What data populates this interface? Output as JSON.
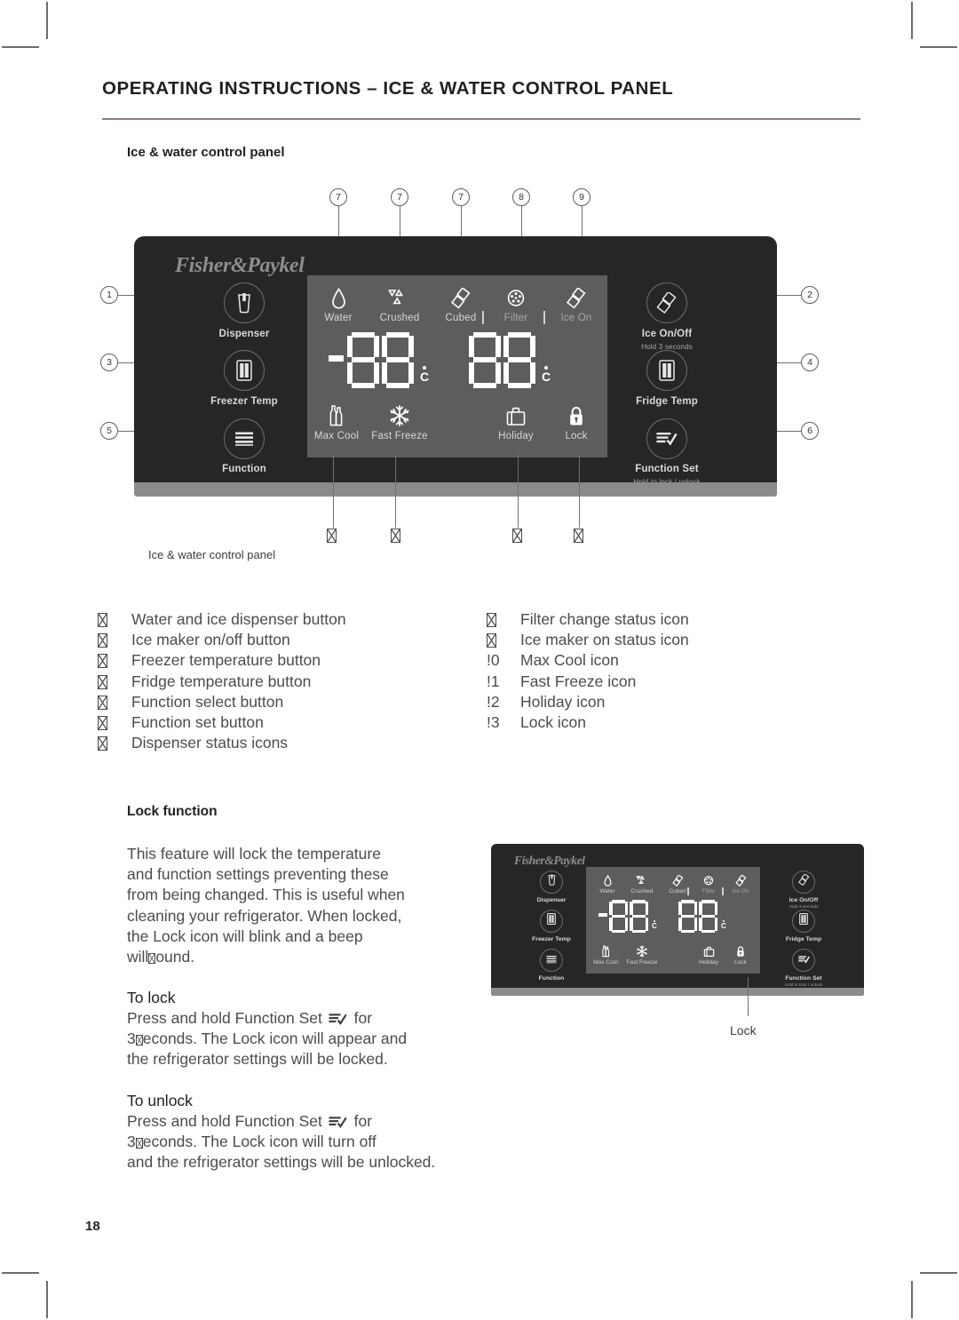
{
  "document": {
    "page_title": "OPERATING INSTRUCTIONS – ICE & WATER CONTROL PANEL",
    "section_heading": "Ice & water control panel",
    "figure_caption": "Ice & water control panel",
    "page_number": "18"
  },
  "panel": {
    "brand": "Fisher&Paykel",
    "buttons_left": [
      {
        "label": "Dispenser",
        "sub": "",
        "icon": "dispenser-icon"
      },
      {
        "label": "Freezer Temp",
        "sub": "",
        "icon": "freezer-icon"
      },
      {
        "label": "Function",
        "sub": "",
        "icon": "function-icon"
      }
    ],
    "buttons_right": [
      {
        "label": "Ice On/Off",
        "sub": "Hold 3 seconds",
        "icon": "ice-cube-icon"
      },
      {
        "label": "Fridge Temp",
        "sub": "",
        "icon": "fridge-icon"
      },
      {
        "label": "Function Set",
        "sub": "Hold to lock / unlock",
        "icon": "function-set-icon"
      }
    ],
    "lcd_top_icons": [
      {
        "label": "Water",
        "icon": "water-drop-icon",
        "dim": false
      },
      {
        "label": "Crushed",
        "icon": "crushed-ice-icon",
        "dim": false
      },
      {
        "label": "Cubed",
        "icon": "cubed-ice-icon",
        "dim": false
      },
      {
        "label": "Filter",
        "icon": "filter-icon",
        "dim": true
      },
      {
        "label": "Ice On",
        "icon": "ice-cube-icon",
        "dim": true
      }
    ],
    "lcd_bottom_icons": [
      {
        "label": "Max Cool",
        "icon": "bottles-icon"
      },
      {
        "label": "Fast Freeze",
        "icon": "snowflake-icon"
      },
      {
        "label": "Holiday",
        "icon": "suitcase-icon"
      },
      {
        "label": "Lock",
        "icon": "padlock-icon"
      }
    ],
    "display_left": {
      "sign": "-",
      "value": "88",
      "unit": "C"
    },
    "display_right": {
      "sign": "",
      "value": "88",
      "unit": "C"
    }
  },
  "callouts": {
    "left": [
      "1",
      "3",
      "5"
    ],
    "right": [
      "2",
      "4",
      "6"
    ],
    "top": [
      "7",
      "7",
      "7",
      "8",
      "9"
    ],
    "bottom": [
      "▯",
      "▯",
      "▯",
      "▯"
    ]
  },
  "legend": {
    "left_column": [
      {
        "num": "▯",
        "text": "Water and ice dispenser button"
      },
      {
        "num": "▯",
        "text": "Ice maker on/off button"
      },
      {
        "num": "▯",
        "text": "Freezer temperature button"
      },
      {
        "num": "▯",
        "text": "Fridge temperature button"
      },
      {
        "num": "▯",
        "text": "Function select button"
      },
      {
        "num": "▯",
        "text": "Function set button"
      },
      {
        "num": "▯",
        "text": "Dispenser status icons"
      }
    ],
    "right_column": [
      {
        "num": "▯",
        "text": "Filter change status icon"
      },
      {
        "num": "▯",
        "text": "Ice maker on status icon"
      },
      {
        "num": "!0",
        "text": "Max Cool icon"
      },
      {
        "num": "!1",
        "text": "Fast Freeze icon"
      },
      {
        "num": "!2",
        "text": "Holiday icon"
      },
      {
        "num": "!3",
        "text": "Lock icon"
      }
    ]
  },
  "lock_function": {
    "heading": "Lock function",
    "intro_line1": "This feature will lock the temperature",
    "intro_line2": "and function settings preventing these",
    "intro_line3": "from being changed. This is useful when",
    "intro_line4": "cleaning your refrigerator. When locked,",
    "intro_line5": "the Lock icon will blink and a beep",
    "intro_line6a": "will",
    "intro_line6b": "ound.",
    "to_lock_heading": "To lock",
    "to_lock_a": "Press and hold Function Set",
    "to_lock_b": "for",
    "to_lock_c": "3",
    "to_lock_d": "econds. The Lock icon will appear and",
    "to_lock_e": "the refrigerator settings will be locked.",
    "to_unlock_heading": "To unlock",
    "to_unlock_a": "Press and hold Function Set",
    "to_unlock_b": "for",
    "to_unlock_c": "3",
    "to_unlock_d": "econds. The Lock icon will turn off",
    "to_unlock_e": "and the refrigerator settings will be unlocked.",
    "mini_caption": "Lock"
  },
  "colors": {
    "panel_bg": "#262527",
    "lcd_bg": "#5d5d60",
    "panel_foot": "#8b8b8e",
    "text": "#4f4a50",
    "heading": "#231f20",
    "rule": "#8a7f85"
  }
}
